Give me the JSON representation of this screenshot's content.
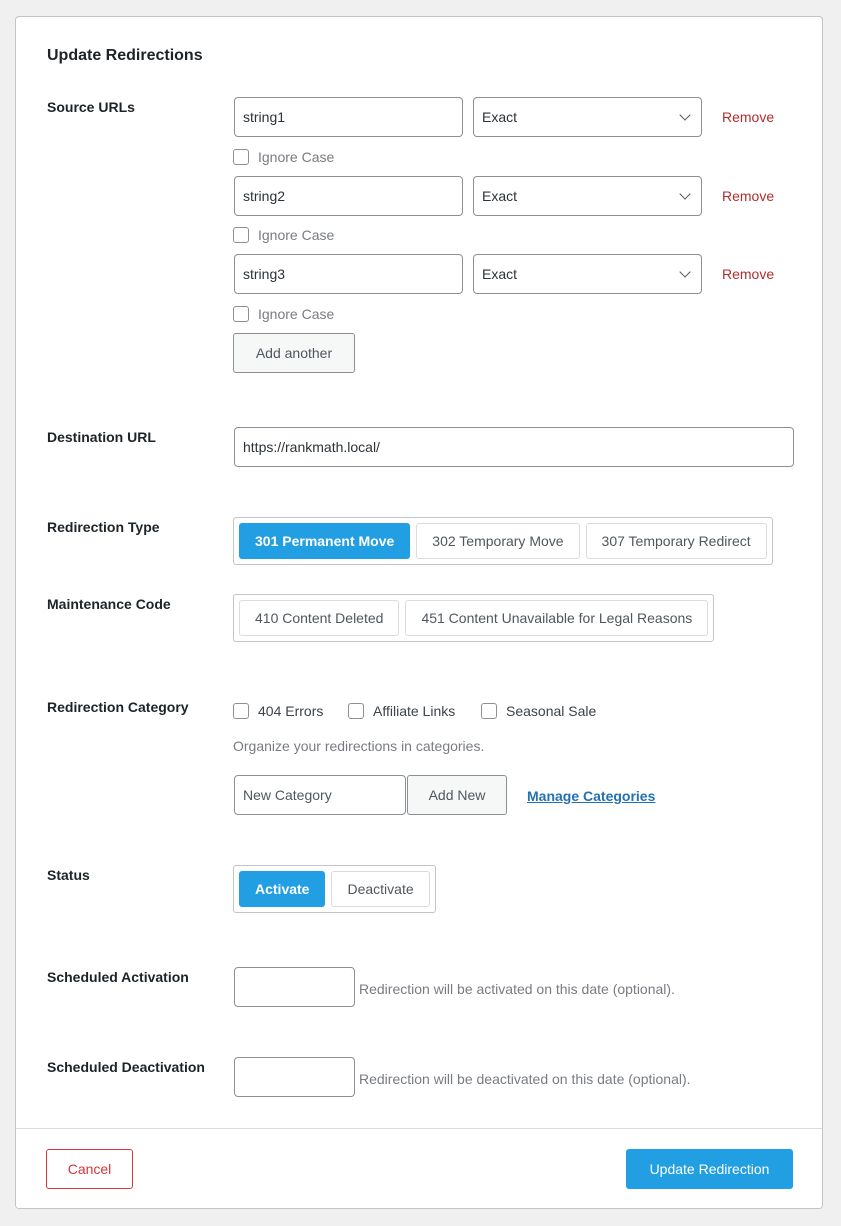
{
  "title": "Update Redirections",
  "source": {
    "label": "Source URLs",
    "rows": [
      {
        "value": "string1",
        "match": "Exact",
        "remove": "Remove",
        "ignore": "Ignore Case"
      },
      {
        "value": "string2",
        "match": "Exact",
        "remove": "Remove",
        "ignore": "Ignore Case"
      },
      {
        "value": "string3",
        "match": "Exact",
        "remove": "Remove",
        "ignore": "Ignore Case"
      }
    ],
    "add_another": "Add another"
  },
  "destination": {
    "label": "Destination URL",
    "value": "https://rankmath.local/"
  },
  "type": {
    "label": "Redirection Type",
    "options": [
      "301 Permanent Move",
      "302 Temporary Move",
      "307 Temporary Redirect"
    ],
    "selected": "301 Permanent Move"
  },
  "maintenance": {
    "label": "Maintenance Code",
    "options": [
      "410 Content Deleted",
      "451 Content Unavailable for Legal Reasons"
    ]
  },
  "category": {
    "label": "Redirection Category",
    "options": [
      "404 Errors",
      "Affiliate Links",
      "Seasonal Sale"
    ],
    "hint": "Organize your redirections in categories.",
    "new_placeholder": "New Category",
    "add_new": "Add New",
    "manage": "Manage Categories"
  },
  "status": {
    "label": "Status",
    "options": [
      "Activate",
      "Deactivate"
    ],
    "selected": "Activate"
  },
  "activation": {
    "label": "Scheduled Activation",
    "hint": "Redirection will be activated on this date (optional)."
  },
  "deactivation": {
    "label": "Scheduled Deactivation",
    "hint": "Redirection will be deactivated on this date (optional)."
  },
  "footer": {
    "cancel": "Cancel",
    "submit": "Update Redirection"
  },
  "colors": {
    "accent": "#229fe3",
    "remove": "#b32d2e",
    "link": "#2271b1",
    "cancel": "#d63638"
  }
}
